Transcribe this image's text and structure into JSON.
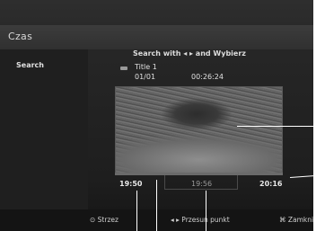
{
  "screen": {
    "title": "Czas"
  },
  "sidebar": {
    "item": "Search"
  },
  "instruction": "Search with ◂ ▸ and Wybierz",
  "disc": {
    "title": "Title 1",
    "chapter": "01/01",
    "elapsed": "00:26:24"
  },
  "timeline": {
    "start": "19:50",
    "marker": "19:56",
    "end": "20:16"
  },
  "buttons": {
    "protect": "⊙ Strzez",
    "move_point": "◂ ▸ Przesuń punkt",
    "close": "⌘ Zamknij"
  },
  "colors": {
    "background": "#222222",
    "text": "#e0e0e0",
    "callout_lines": "#ffffff"
  }
}
